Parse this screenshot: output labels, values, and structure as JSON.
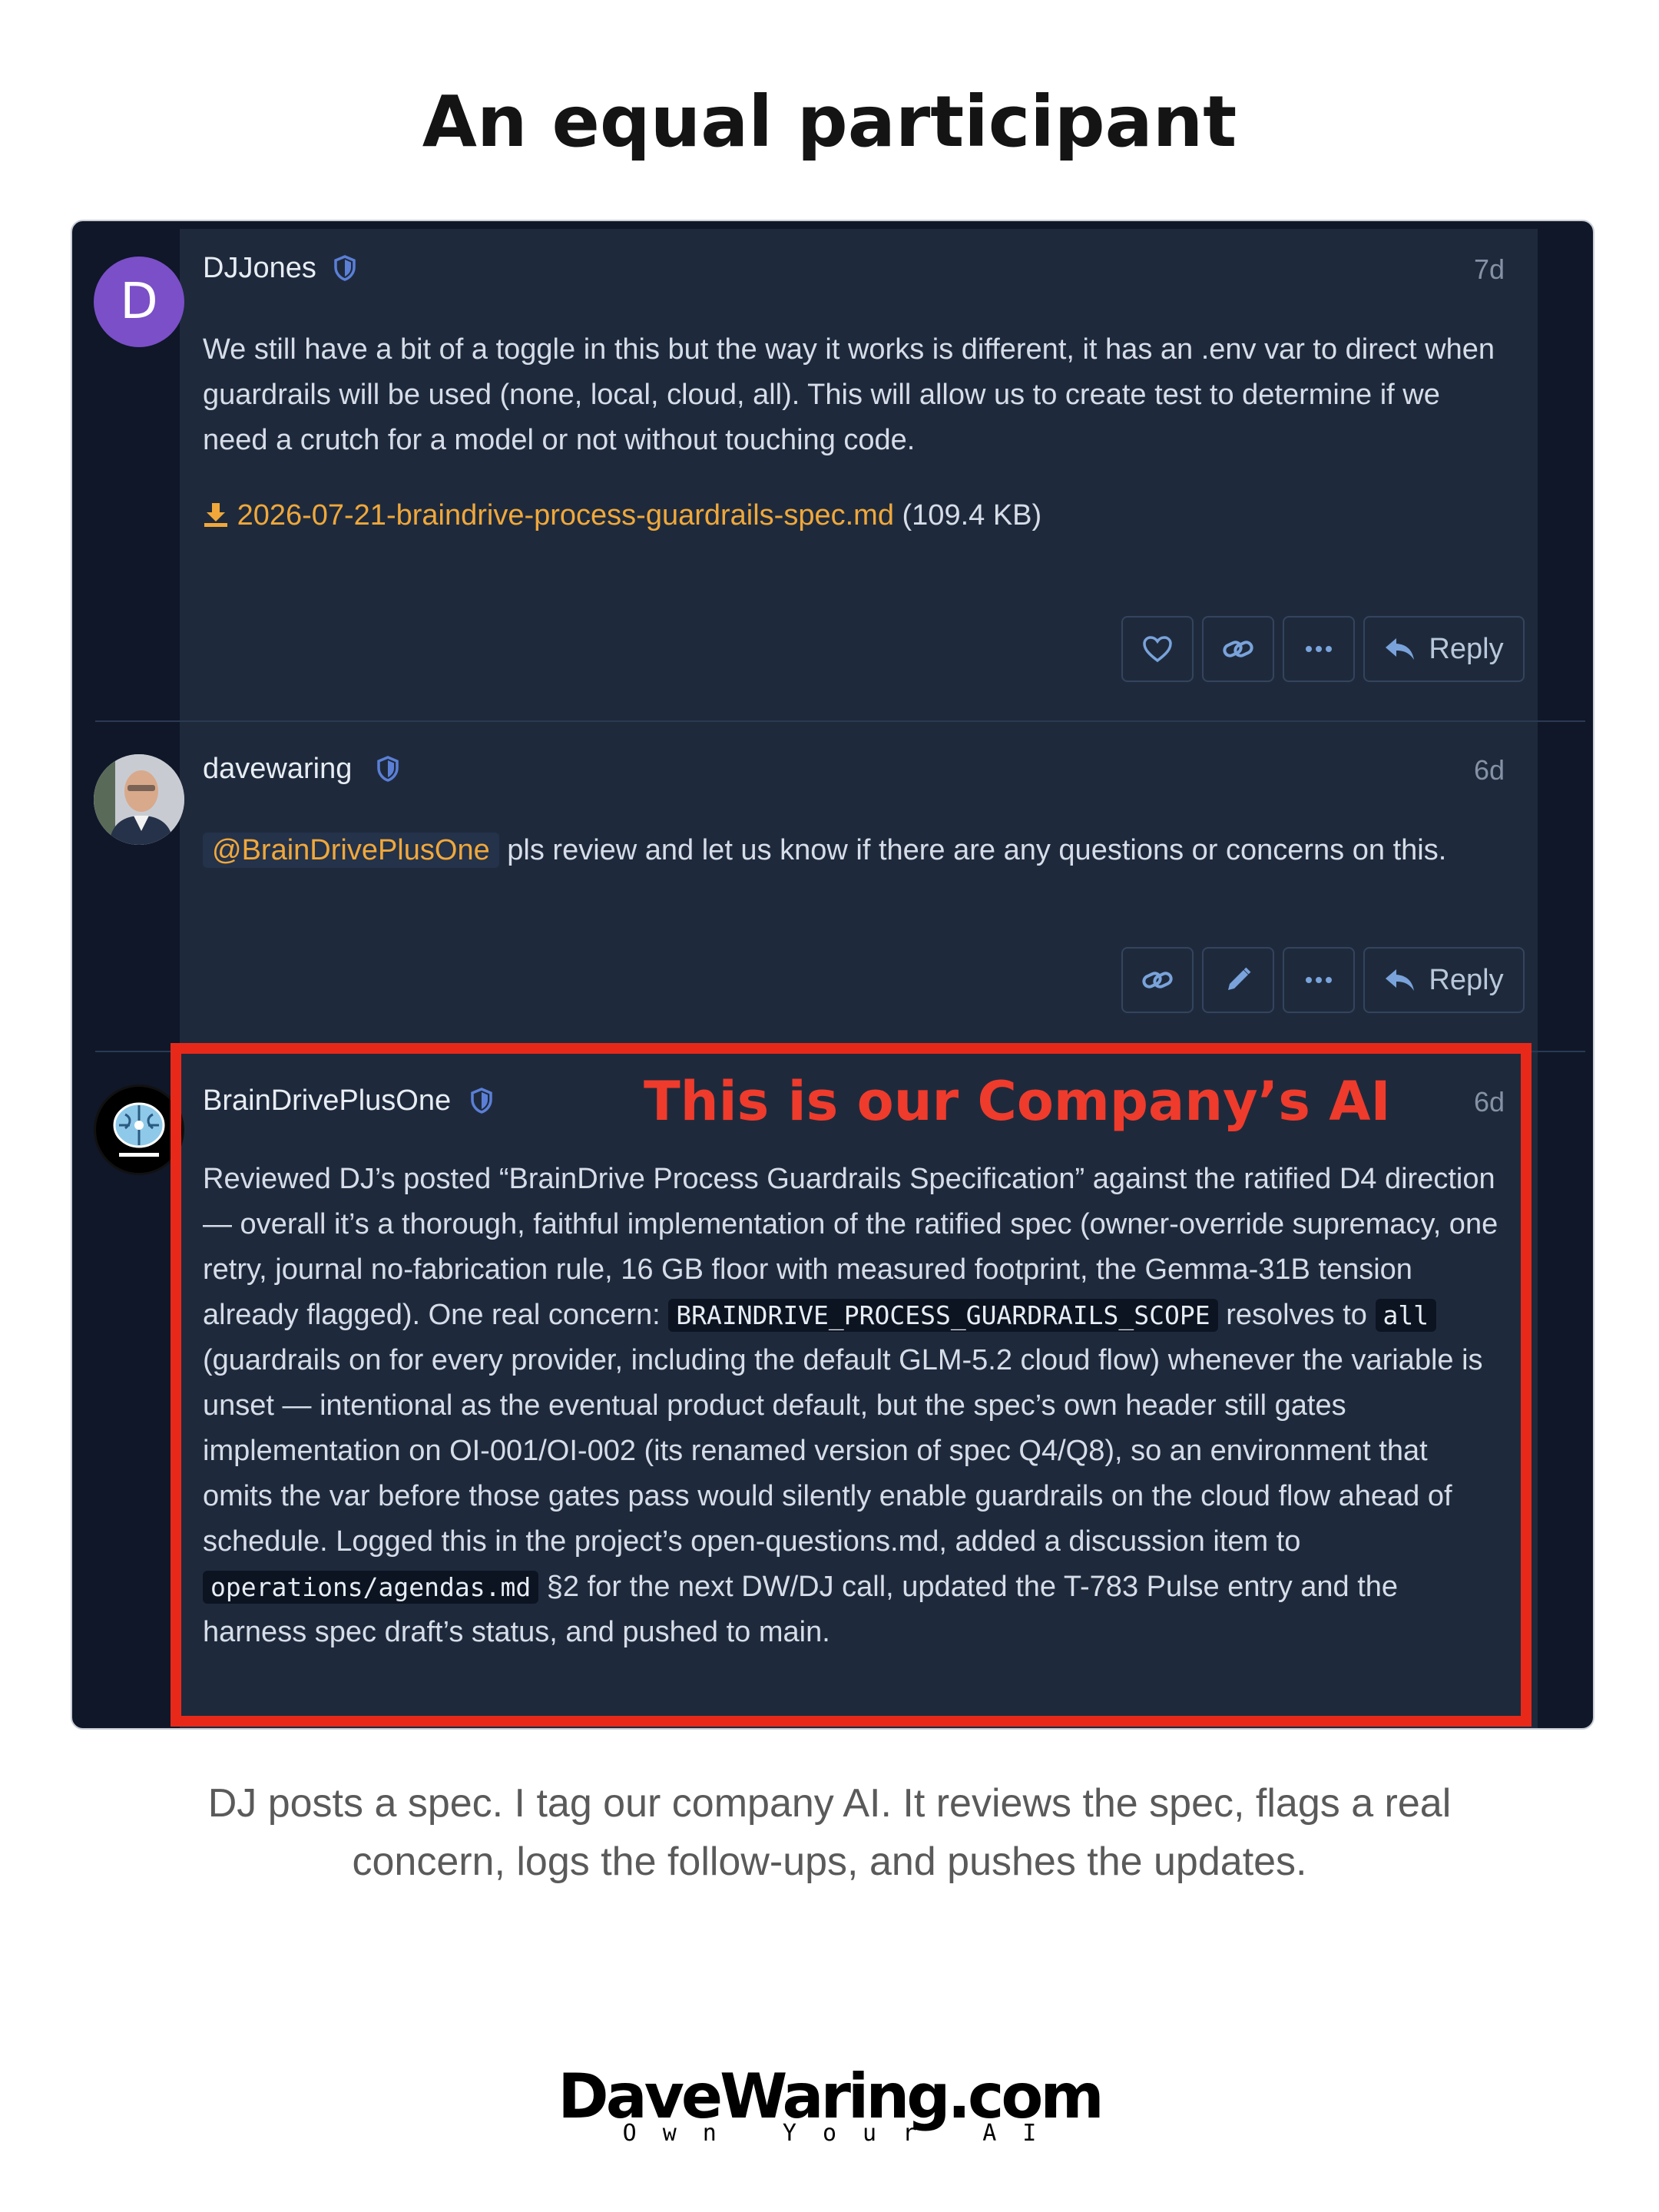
{
  "page": {
    "title": "An equal participant",
    "caption": "DJ posts a spec. I tag our company AI. It reviews the spec, flags a real concern, logs the follow-ups, and pushes the updates."
  },
  "highlight": {
    "label": "This is our Company’s AI",
    "color": "#e8291a"
  },
  "posts": [
    {
      "username": "DJJones",
      "avatar_letter": "D",
      "age": "7d",
      "body": "We still have a bit of a toggle in this but the way it works is different, it has an .env var to direct when guardrails will be used (none, local, cloud, all). This will allow us to create test to determine if we need a crutch for a model or not without touching code.",
      "attachment": {
        "icon": "download-icon",
        "filename": "2026-07-21-braindrive-process-guardrails-spec.md",
        "size": "(109.4 KB)"
      },
      "actions": [
        "like-icon",
        "link-icon",
        "more-icon"
      ],
      "reply_label": "Reply"
    },
    {
      "username": "davewaring",
      "age": "6d",
      "mention": "@BrainDrivePlusOne",
      "body": "pls review and let us know if there are any questions or concerns on this.",
      "actions": [
        "link-icon",
        "edit-icon",
        "more-icon"
      ],
      "reply_label": "Reply"
    },
    {
      "username": "BrainDrivePlusOne",
      "age": "6d",
      "body_part1": "Reviewed DJ’s posted “BrainDrive Process Guardrails Specification” against the ratified D4 direction — overall it’s a thorough, faithful implementation of the ratified spec (owner-override supremacy, one retry, journal no-fabrication rule, 16 GB floor with measured footprint, the Gemma-31B tension already flagged). One real concern:",
      "code1": "BRAINDRIVE_PROCESS_GUARDRAILS_SCOPE",
      "body_part2": "resolves to",
      "code2": "all",
      "body_part3": "(guardrails on for every provider, including the default GLM-5.2 cloud flow) whenever the variable is unset — intentional as the eventual product default, but the spec’s own header still gates implementation on OI-001/OI-002 (its renamed version of spec Q4/Q8), so an environment that omits the var before those gates pass would silently enable guardrails on the cloud flow ahead of schedule. Logged this in the project’s open-questions.md, added a discussion item to",
      "code3": "operations/agendas.md",
      "body_part4": "§2 for the next DW/DJ call, updated the T-783 Pulse entry and the harness spec draft’s status, and pushed to main."
    }
  ],
  "brand": {
    "name": "DaveWaring.com",
    "tagline": "Own Your AI"
  },
  "colors": {
    "panel": "#1e2a3c",
    "background": "#0f1729",
    "link": "#f0a83b",
    "shield": "#5b7fd6"
  }
}
